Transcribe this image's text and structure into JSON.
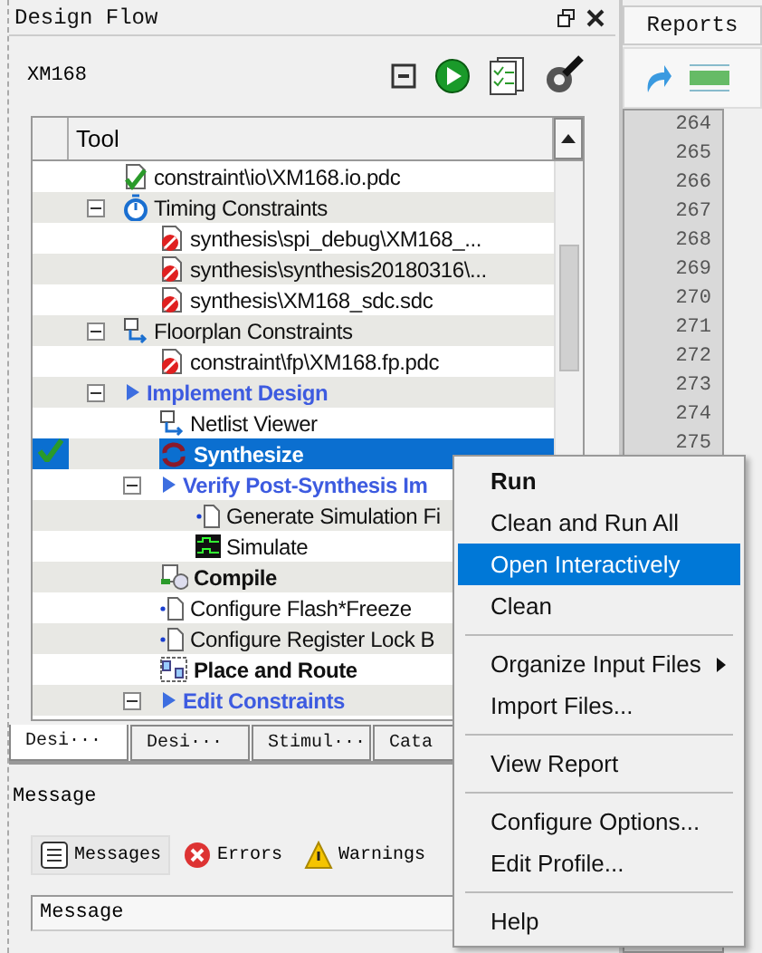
{
  "design_flow": {
    "title": "Design Flow",
    "project": "XM168"
  },
  "tree": {
    "column": "Tool",
    "items": [
      {
        "children": [
          {
            "children": [
              {
                "label": "constraint\\io\\XM168.io.pdc",
                "kind": "file-ok",
                "selected": false
              }
            ]
          },
          {
            "label": "Timing Constraints",
            "kind": "timer",
            "expanded": true,
            "selected": false,
            "children": [
              {
                "label": "synthesis\\spi_debug\\XM168_...",
                "kind": "file-error",
                "selected": false
              },
              {
                "label": "synthesis\\synthesis20180316\\...",
                "kind": "file-error",
                "selected": false
              },
              {
                "label": "synthesis\\XM168_sdc.sdc",
                "kind": "file-error",
                "selected": false
              }
            ]
          },
          {
            "label": "Floorplan Constraints",
            "kind": "flow",
            "expanded": true,
            "selected": false,
            "children": [
              {
                "label": "constraint\\fp\\XM168.fp.pdc",
                "kind": "file-error",
                "selected": false
              }
            ]
          }
        ]
      },
      {
        "label": "Implement Design",
        "kind": "step",
        "expanded": true,
        "selected": false,
        "children": [
          {
            "label": "Netlist Viewer",
            "kind": "flow",
            "selected": false
          },
          {
            "label": "Synthesize",
            "kind": "cycle",
            "selected": true,
            "done": true
          },
          {
            "label": "Verify Post-Synthesis Im",
            "kind": "step",
            "expanded": true,
            "selected": false,
            "children": [
              {
                "label": "Generate Simulation Fi",
                "kind": "doc",
                "selected": false
              },
              {
                "label": "Simulate",
                "kind": "wave",
                "selected": false
              }
            ]
          },
          {
            "label": "Compile",
            "kind": "compile",
            "selected": false
          },
          {
            "label": "Configure Flash*Freeze",
            "kind": "doc",
            "selected": false
          },
          {
            "label": "Configure Register Lock B",
            "kind": "doc",
            "selected": false
          },
          {
            "label": "Place and Route",
            "kind": "place",
            "selected": false
          },
          {
            "label": "Edit Constraints",
            "kind": "step",
            "expanded": true,
            "selected": false
          }
        ]
      }
    ]
  },
  "bottom_tabs": [
    {
      "label": "Desi···",
      "selected": true
    },
    {
      "label": "Desi···",
      "selected": false
    },
    {
      "label": "Stimul···",
      "selected": false
    },
    {
      "label": "Cata",
      "selected": false
    }
  ],
  "message": {
    "title": "Message",
    "tabs": [
      {
        "label": "Messages",
        "kind": "list",
        "selected": true
      },
      {
        "label": "Errors",
        "kind": "error",
        "selected": false
      },
      {
        "label": "Warnings",
        "kind": "warning",
        "selected": false
      }
    ],
    "column": "Message"
  },
  "reports": {
    "tab": "Reports",
    "lines": [
      "264",
      "265",
      "266",
      "267",
      "268",
      "269",
      "270",
      "271",
      "272",
      "273",
      "274",
      "275"
    ]
  },
  "context_menu": [
    {
      "kind": "item",
      "label": "Run",
      "bold": true,
      "selected": false
    },
    {
      "kind": "item",
      "label": "Clean and Run All",
      "selected": false
    },
    {
      "kind": "item",
      "label": "Open Interactively",
      "selected": true
    },
    {
      "kind": "item",
      "label": "Clean",
      "selected": false
    },
    {
      "kind": "separator"
    },
    {
      "kind": "item",
      "label": "Organize Input Files",
      "submenu": true,
      "selected": false
    },
    {
      "kind": "item",
      "label": "Import Files...",
      "selected": false
    },
    {
      "kind": "separator"
    },
    {
      "kind": "item",
      "label": "View Report",
      "selected": false
    },
    {
      "kind": "separator"
    },
    {
      "kind": "item",
      "label": "Configure Options...",
      "selected": false
    },
    {
      "kind": "item",
      "label": "Edit Profile...",
      "selected": false
    },
    {
      "kind": "separator"
    },
    {
      "kind": "item",
      "label": "Help",
      "selected": false
    }
  ]
}
